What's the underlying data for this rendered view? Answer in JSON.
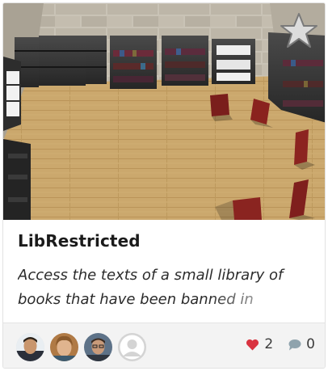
{
  "project": {
    "title": "LibRestricted",
    "description": "Access the texts of a small library of books that have been banned in",
    "likes": "2",
    "comments": "0"
  },
  "contributors": [
    {
      "name": "contributor-1"
    },
    {
      "name": "contributor-2"
    },
    {
      "name": "contributor-3"
    },
    {
      "name": "contributor-4-default"
    }
  ],
  "icons": {
    "favorite": "star-icon",
    "like": "heart-icon",
    "comment": "speech-bubble-icon"
  },
  "colors": {
    "heart": "#d93340",
    "comment": "#8fa3ad",
    "star": "#dcdcdc",
    "floor": "#d2ab6e"
  }
}
